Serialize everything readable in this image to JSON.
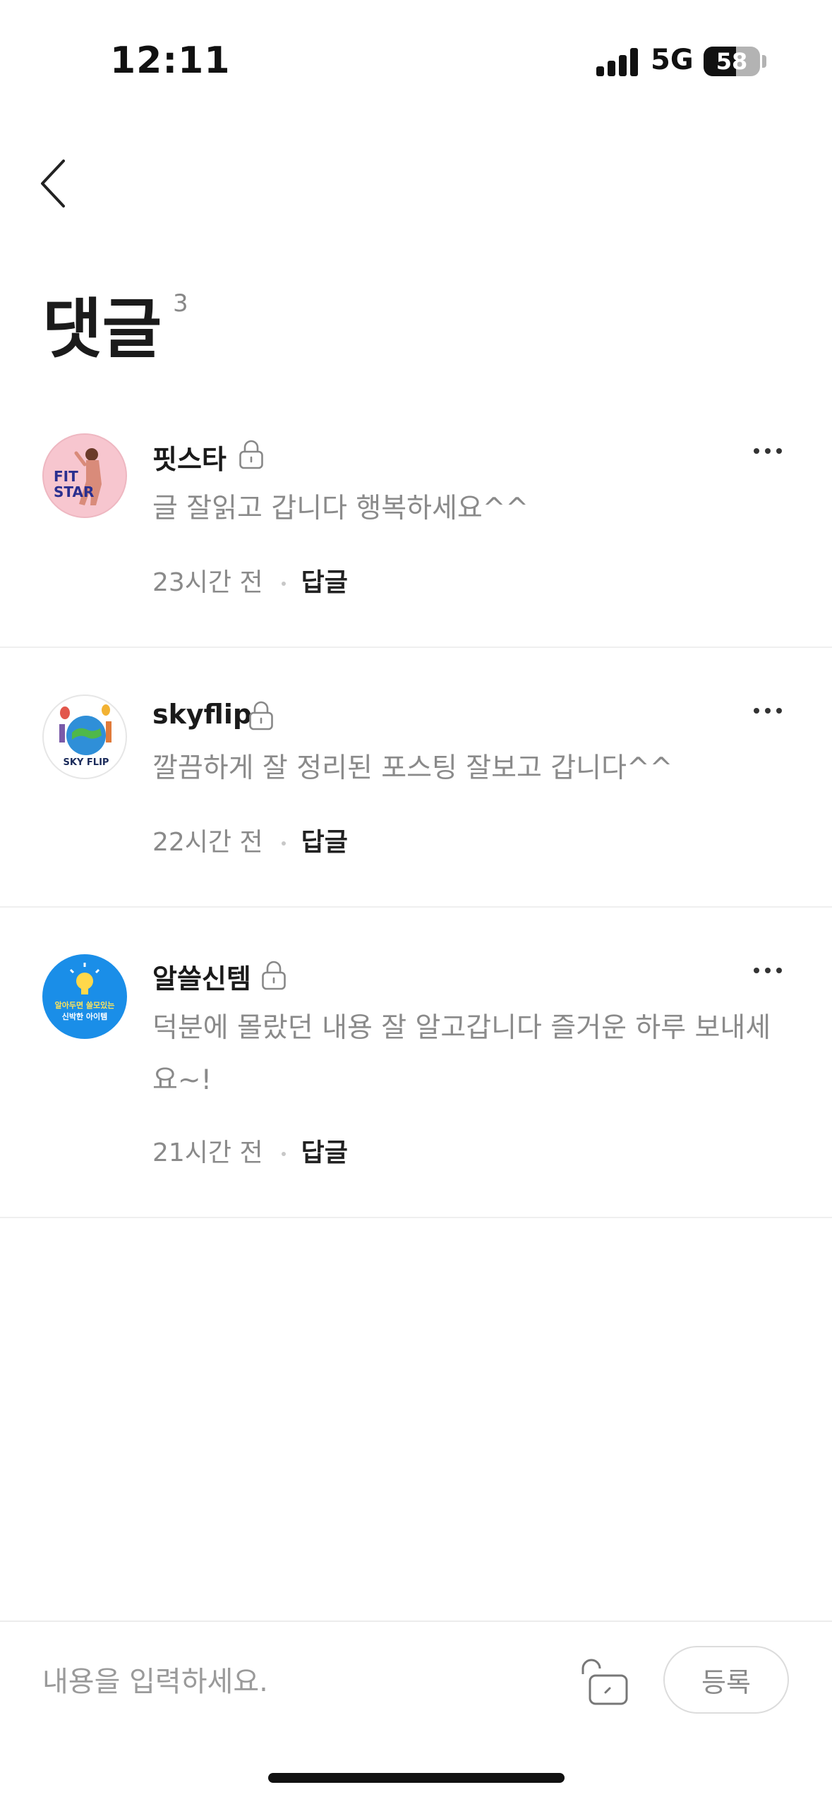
{
  "status_bar": {
    "time": "12:11",
    "network": "5G",
    "battery": "58",
    "battery_level": 0.58
  },
  "header": {
    "back_icon": "chevron-left-icon",
    "title": "댓글",
    "count": "3"
  },
  "comments": [
    {
      "username": "핏스타",
      "avatar_text": [
        "FIT",
        "STAR"
      ],
      "text": "글 잘읽고 갑니다 행복하세요^^",
      "time": "23시간 전",
      "reply": "답글",
      "lock_icon": "lock-icon",
      "more_icon": "more-horizontal-icon"
    },
    {
      "username": "skyflip",
      "avatar_text": [
        "SKY FLIP"
      ],
      "text": "깔끔하게 잘 정리된 포스팅 잘보고 갑니다^^",
      "time": "22시간 전",
      "reply": "답글",
      "lock_icon": "lock-icon",
      "more_icon": "more-horizontal-icon"
    },
    {
      "username": "알쓸신템",
      "avatar_text": [
        "알아두면 쓸모있는",
        "신박한 아이템"
      ],
      "text_lines": [
        "덕분에 몰랐던 내용 잘 알고갑니다 즐거운 하루 보내세",
        "요~!"
      ],
      "time": "21시간 전",
      "reply": "답글",
      "lock_icon": "lock-icon",
      "more_icon": "more-horizontal-icon"
    }
  ],
  "input_bar": {
    "placeholder": "내용을 입력하세요.",
    "unlock_icon": "unlock-icon",
    "submit_label": "등록"
  },
  "colors": {
    "text_primary": "#111111",
    "text_secondary": "#8a8a8a",
    "divider": "#efefef",
    "avatar1_bg": "#f7c6cf",
    "avatar3_bg": "#1a8ee8"
  }
}
